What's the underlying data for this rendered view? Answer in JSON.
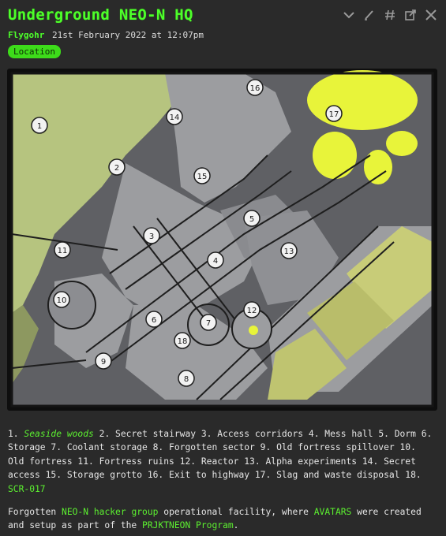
{
  "post": {
    "title": "Underground NEO-N HQ",
    "author": "Flygohr",
    "date": "21st February 2022 at 12:07pm",
    "tag": "Location"
  },
  "toolbar": {
    "icons": [
      "chevron-down-icon",
      "pencil-icon",
      "hash-icon",
      "open-external-icon",
      "close-icon"
    ]
  },
  "map": {
    "labels": [
      "1",
      "2",
      "3",
      "4",
      "5",
      "6",
      "7",
      "8",
      "9",
      "10",
      "11",
      "12",
      "13",
      "14",
      "15",
      "16",
      "17",
      "18"
    ],
    "colors": {
      "grass": "#b6c47f",
      "yellow": "#e8f43a",
      "stone": "#9c9da0",
      "dark": "#5f6064"
    }
  },
  "legend": {
    "n1": "1.",
    "t1": "Seaside woods",
    "rest1": "2. Secret stairway 3. Access corridors 4. Mess hall 5. Dorm 6. Storage 7. Coolant storage 8. Forgotten sector 9. Old fortress spillover 10. Old fortress 11. Fortress ruins 12. Reactor 13. Alpha experiments 14. Secret access 15. Storage grotto 16. Exit to highway 17. Slag and waste disposal 18.",
    "t18": "SCR-017"
  },
  "description": {
    "p1": "Forgotten",
    "link1": "NEO-N hacker group",
    "p2": "operational facility, where",
    "link2": "AVATARS",
    "p3": "were created and setup as part of the",
    "link3": "PRJKTNEON Program",
    "p4": "."
  }
}
